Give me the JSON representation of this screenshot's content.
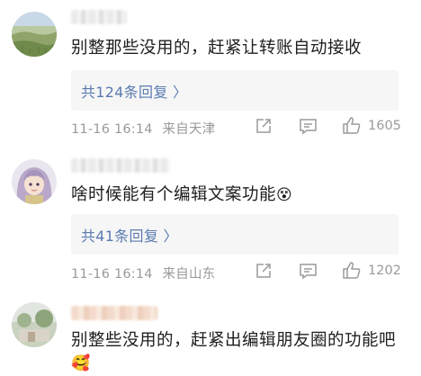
{
  "comments": [
    {
      "text": "别整那些没用的，赶紧让转账自动接收",
      "replies_label": "共124条回复 〉",
      "datetime": "11-16 16:14",
      "location": "来自天津",
      "likes": "1605"
    },
    {
      "text": "啥时候能有个编辑文案功能",
      "emoji": "😵",
      "replies_label": "共41条回复 〉",
      "datetime": "11-16 16:14",
      "location": "来自山东",
      "likes": "1202"
    },
    {
      "text": "别整些没用的，赶紧出编辑朋友圈的功能吧",
      "emoji": "🥰"
    }
  ],
  "icons": {
    "share": "share-icon",
    "comment": "comment-icon",
    "like": "thumbs-up-icon"
  },
  "colors": {
    "link": "#5a7ab0",
    "meta": "#9a9a9a",
    "reply_bg": "#f6f6f6"
  }
}
